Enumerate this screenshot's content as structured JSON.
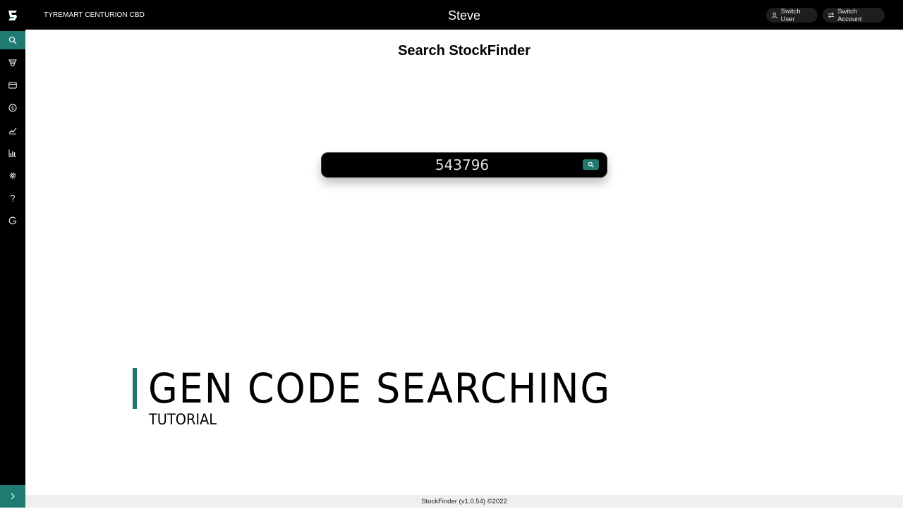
{
  "header": {
    "store_name": "TYREMART CENTURION CBD",
    "user_name": "Steve",
    "switch_user_label": "Switch User",
    "switch_account_label": "Switch Account"
  },
  "sidebar": {
    "items": [
      {
        "icon": "search-icon",
        "active": true
      },
      {
        "icon": "tyre-icon",
        "active": false
      },
      {
        "icon": "card-icon",
        "active": false
      },
      {
        "icon": "dollar-icon",
        "active": false
      },
      {
        "icon": "line-chart-icon",
        "active": false
      },
      {
        "icon": "bar-chart-icon",
        "active": false
      },
      {
        "icon": "gear-icon",
        "active": false
      },
      {
        "icon": "help-icon",
        "active": false
      },
      {
        "icon": "logout-icon",
        "active": false
      }
    ],
    "expand_icon": "chevron-right-icon"
  },
  "main": {
    "title": "Search StockFinder",
    "search": {
      "value": "543796",
      "placeholder": ""
    }
  },
  "overlay": {
    "title": "GEN CODE SEARCHING",
    "subtitle": "TUTORIAL"
  },
  "footer": {
    "text": "StockFinder (v1.0.54) ©2022"
  },
  "colors": {
    "accent": "#1f7a70",
    "topbar": "#000000",
    "sidebar": "#000000",
    "footer_bg": "#efefef"
  }
}
